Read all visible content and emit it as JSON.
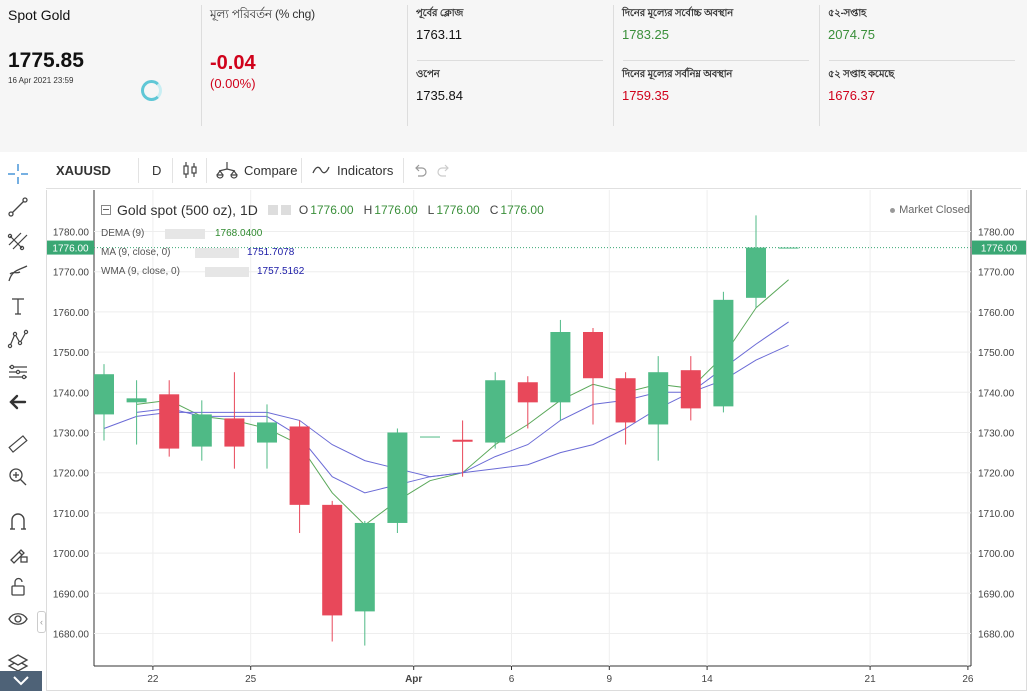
{
  "quote": {
    "symbol_name": "Spot Gold",
    "price": "1775.85",
    "timestamp": "16 Apr 2021 23:59",
    "change_label": "মূল্য পরিবর্তন (% chg)",
    "change": "-0.04",
    "change_pct": "(0.00%)",
    "prev_close_label": "পূর্বের ক্লোজ",
    "prev_close": "1763.11",
    "open_label": "ওপেন",
    "open": "1735.84",
    "day_high_label": "দিনের মূল্যের সর্বোচ্চ অবস্থান",
    "day_high": "1783.25",
    "day_low_label": "দিনের মূল্যের সর্বনিম্ন অবস্থান",
    "day_low": "1759.35",
    "week52_high_label": "৫২-সপ্তাহ",
    "week52_high": "2074.75",
    "week52_low_label": "৫২ সপ্তাহ কমেছে",
    "week52_low": "1676.37",
    "colors": {
      "positive": "#3a8f3a",
      "negative": "#d0021b"
    }
  },
  "toolbar": {
    "symbol": "XAUUSD",
    "interval": "D",
    "compare_label": "Compare",
    "indicators_label": "Indicators"
  },
  "left_tools": [
    "crosshair-icon",
    "trend-line-icon",
    "fib-icon",
    "brush-icon",
    "text-icon",
    "pattern-icon",
    "projection-icon",
    "back-arrow-icon",
    "ruler-icon",
    "zoom-in-icon",
    "magnet-icon",
    "lock-drawings-icon",
    "unlock-icon",
    "eye-icon",
    "layers-icon"
  ],
  "legend": {
    "title": "Gold spot (500 oz), 1D",
    "o_label": "O",
    "o_value": "1776.00",
    "h_label": "H",
    "h_value": "1776.00",
    "l_label": "L",
    "l_value": "1776.00",
    "c_label": "C",
    "c_value": "1776.00",
    "market_status": "Market Closed",
    "indicators": [
      {
        "name": "DEMA (9)",
        "value": "1768.0400",
        "color": "#2f8a2f"
      },
      {
        "name": "MA (9, close, 0)",
        "value": "1751.7078",
        "color": "#1a1aa6"
      },
      {
        "name": "WMA (9, close, 0)",
        "value": "1757.5162",
        "color": "#1a1aa6"
      }
    ]
  },
  "chart_data": {
    "type": "candlestick",
    "title": "Gold spot (500 oz), 1D",
    "ylim": [
      1675,
      1784
    ],
    "y_ticks": [
      "1780.00",
      "1770.00",
      "1760.00",
      "1750.00",
      "1740.00",
      "1730.00",
      "1720.00",
      "1710.00",
      "1700.00",
      "1690.00",
      "1680.00"
    ],
    "x_ticks": [
      {
        "label": "22",
        "d": 1.5
      },
      {
        "label": "25",
        "d": 4.5
      },
      {
        "label": "Apr",
        "d": 9.5
      },
      {
        "label": "6",
        "d": 12.5
      },
      {
        "label": "9",
        "d": 15.5
      },
      {
        "label": "14",
        "d": 18.5
      },
      {
        "label": "21",
        "d": 23.5
      },
      {
        "label": "26",
        "d": 26.5
      }
    ],
    "last_price_label": "1776.00",
    "last_price": 1776.0,
    "candles": [
      {
        "d": 0,
        "o": 1734.5,
        "h": 1747,
        "l": 1728,
        "c": 1744.5
      },
      {
        "d": 1,
        "o": 1737.5,
        "h": 1743,
        "l": 1727,
        "c": 1738.5
      },
      {
        "d": 2,
        "o": 1739.5,
        "h": 1743,
        "l": 1724,
        "c": 1726.0
      },
      {
        "d": 3,
        "o": 1726.5,
        "h": 1738,
        "l": 1723,
        "c": 1734.5
      },
      {
        "d": 4,
        "o": 1733.5,
        "h": 1745,
        "l": 1721,
        "c": 1726.5
      },
      {
        "d": 5,
        "o": 1727.5,
        "h": 1737,
        "l": 1721,
        "c": 1732.5
      },
      {
        "d": 6,
        "o": 1731.5,
        "h": 1733,
        "l": 1705,
        "c": 1712.0
      },
      {
        "d": 7,
        "o": 1712.0,
        "h": 1713,
        "l": 1678,
        "c": 1684.5
      },
      {
        "d": 8,
        "o": 1685.5,
        "h": 1708,
        "l": 1677,
        "c": 1707.5
      },
      {
        "d": 9,
        "o": 1707.5,
        "h": 1731,
        "l": 1705,
        "c": 1730.0
      },
      {
        "d": 10,
        "o": 1729.0,
        "h": 1729,
        "l": 1729,
        "c": 1729.0
      },
      {
        "d": 11,
        "o": 1728.2,
        "h": 1733,
        "l": 1719,
        "c": 1727.7
      },
      {
        "d": 12,
        "o": 1727.5,
        "h": 1745,
        "l": 1726,
        "c": 1743.0
      },
      {
        "d": 13,
        "o": 1742.5,
        "h": 1744,
        "l": 1731,
        "c": 1737.5
      },
      {
        "d": 14,
        "o": 1737.5,
        "h": 1758,
        "l": 1733,
        "c": 1755.0
      },
      {
        "d": 15,
        "o": 1755.0,
        "h": 1756,
        "l": 1732,
        "c": 1743.5
      },
      {
        "d": 16,
        "o": 1743.5,
        "h": 1745,
        "l": 1727,
        "c": 1732.5
      },
      {
        "d": 17,
        "o": 1732.0,
        "h": 1749,
        "l": 1723,
        "c": 1745.0
      },
      {
        "d": 18,
        "o": 1745.5,
        "h": 1749,
        "l": 1733,
        "c": 1736.0
      },
      {
        "d": 19,
        "o": 1736.5,
        "h": 1765,
        "l": 1735,
        "c": 1763.0
      },
      {
        "d": 20,
        "o": 1763.5,
        "h": 1784,
        "l": 1761,
        "c": 1776.0
      },
      {
        "d": 21,
        "o": 1776.0,
        "h": 1776,
        "l": 1776,
        "c": 1776.0
      }
    ],
    "series": [
      {
        "name": "DEMA (9)",
        "color": "#5aa85a",
        "points": [
          [
            1,
            1737
          ],
          [
            2,
            1738
          ],
          [
            3,
            1734
          ],
          [
            4,
            1733
          ],
          [
            5,
            1731
          ],
          [
            6,
            1727
          ],
          [
            7,
            1715
          ],
          [
            8,
            1707
          ],
          [
            9,
            1713
          ],
          [
            10,
            1718
          ],
          [
            11,
            1720
          ],
          [
            12,
            1727
          ],
          [
            13,
            1732
          ],
          [
            14,
            1738
          ],
          [
            15,
            1742
          ],
          [
            16,
            1740
          ],
          [
            17,
            1742
          ],
          [
            18,
            1741
          ],
          [
            19,
            1749
          ],
          [
            20,
            1761
          ],
          [
            21,
            1768
          ]
        ]
      },
      {
        "name": "MA (9, close, 0)",
        "color": "#6b6bd6",
        "points": [
          [
            0,
            1731
          ],
          [
            1,
            1734
          ],
          [
            2,
            1735
          ],
          [
            3,
            1735
          ],
          [
            4,
            1735
          ],
          [
            5,
            1735
          ],
          [
            6,
            1733
          ],
          [
            7,
            1727
          ],
          [
            8,
            1723
          ],
          [
            9,
            1721
          ],
          [
            10,
            1719
          ],
          [
            11,
            1720
          ],
          [
            12,
            1721
          ],
          [
            13,
            1722
          ],
          [
            14,
            1725
          ],
          [
            15,
            1727
          ],
          [
            16,
            1731
          ],
          [
            17,
            1736
          ],
          [
            18,
            1740
          ],
          [
            19,
            1743
          ],
          [
            20,
            1748
          ],
          [
            21,
            1751.7
          ]
        ]
      },
      {
        "name": "WMA (9, close, 0)",
        "color": "#6b6bd6",
        "points": [
          [
            1,
            1735
          ],
          [
            2,
            1736
          ],
          [
            3,
            1734
          ],
          [
            4,
            1734
          ],
          [
            5,
            1734
          ],
          [
            6,
            1729
          ],
          [
            7,
            1719
          ],
          [
            8,
            1715
          ],
          [
            9,
            1717
          ],
          [
            10,
            1719
          ],
          [
            11,
            1720
          ],
          [
            12,
            1724
          ],
          [
            13,
            1727
          ],
          [
            14,
            1733
          ],
          [
            15,
            1737
          ],
          [
            16,
            1738
          ],
          [
            17,
            1740
          ],
          [
            18,
            1740
          ],
          [
            19,
            1746
          ],
          [
            20,
            1752
          ],
          [
            21,
            1757.5
          ]
        ]
      }
    ],
    "colors": {
      "up": "#4fba86",
      "down": "#e8485a",
      "grid": "#eeeeee",
      "last_price_line": "#3aa774"
    }
  }
}
